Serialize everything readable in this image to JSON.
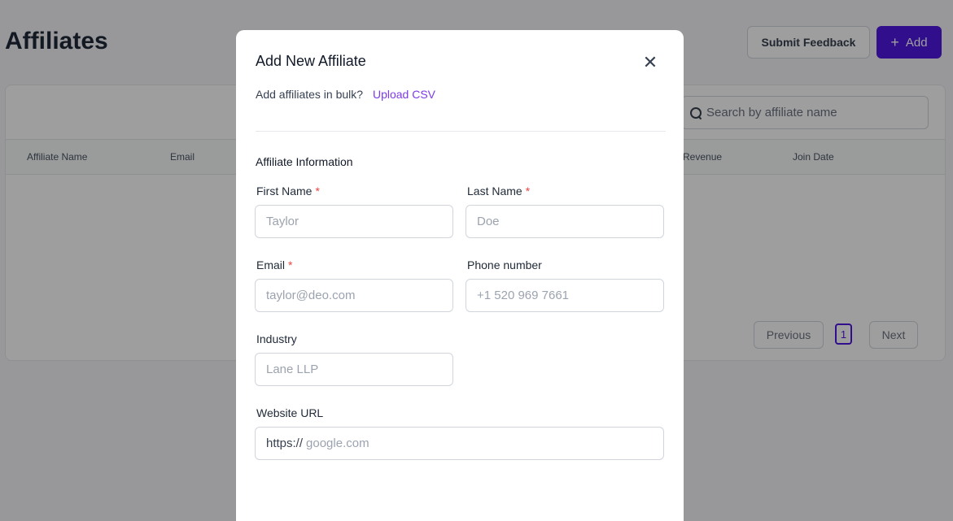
{
  "page": {
    "title": "Affiliates",
    "submit_feedback_label": "Submit Feedback",
    "add_label": "Add",
    "search_placeholder": "Search by affiliate name",
    "columns": [
      "Affiliate Name",
      "Email",
      "Revenue",
      "Join Date"
    ],
    "pagination": {
      "previous": "Previous",
      "current_page": "1",
      "next": "Next"
    }
  },
  "modal": {
    "title": "Add New Affiliate",
    "bulk_prompt": "Add affiliates in bulk?",
    "upload_csv": "Upload CSV",
    "section_title": "Affiliate Information",
    "required_marker": "*",
    "fields": {
      "first_name": {
        "label": "First Name",
        "placeholder": "Taylor",
        "required": true
      },
      "last_name": {
        "label": "Last Name",
        "placeholder": "Doe",
        "required": true
      },
      "email": {
        "label": "Email",
        "placeholder": "taylor@deo.com",
        "required": true
      },
      "phone": {
        "label": "Phone number",
        "placeholder": "+1 520 969 7661",
        "required": false
      },
      "industry": {
        "label": "Industry",
        "placeholder": "Lane LLP",
        "required": false
      },
      "website": {
        "label": "Website URL",
        "prefix": "https://",
        "placeholder": "google.com",
        "required": false
      }
    }
  },
  "colors": {
    "accent": "#4f18e0",
    "link": "#7c3aed",
    "required": "#ef4444"
  },
  "icons": {
    "close": "close-icon",
    "search": "search-icon",
    "plus": "plus-icon"
  }
}
